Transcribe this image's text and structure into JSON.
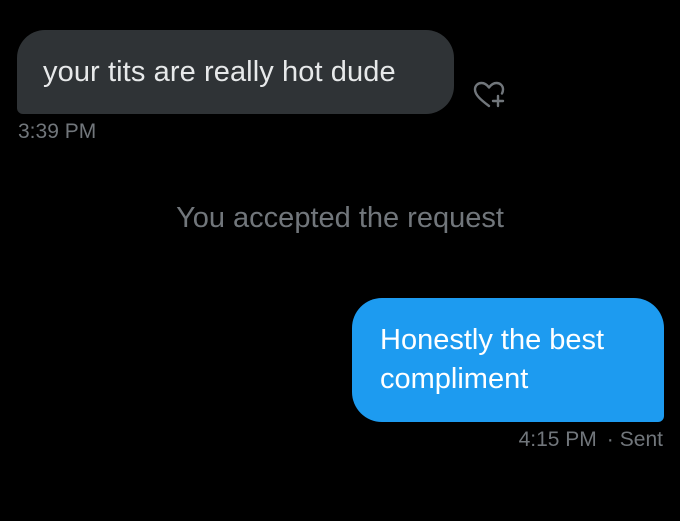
{
  "messages": {
    "incoming": {
      "text": "your tits are really hot dude",
      "time": "3:39 PM"
    },
    "system": {
      "text": "You accepted the request"
    },
    "outgoing": {
      "line1": "Honestly the best",
      "line2": "compliment",
      "time": "4:15 PM",
      "separator": "·",
      "status": "Sent"
    }
  },
  "icons": {
    "react": "heart-plus-icon"
  },
  "colors": {
    "background": "#000000",
    "incoming_bubble": "#2f3336",
    "outgoing_bubble": "#1d9bf0",
    "muted_text": "#71767b",
    "primary_text": "#e7e9ea"
  }
}
